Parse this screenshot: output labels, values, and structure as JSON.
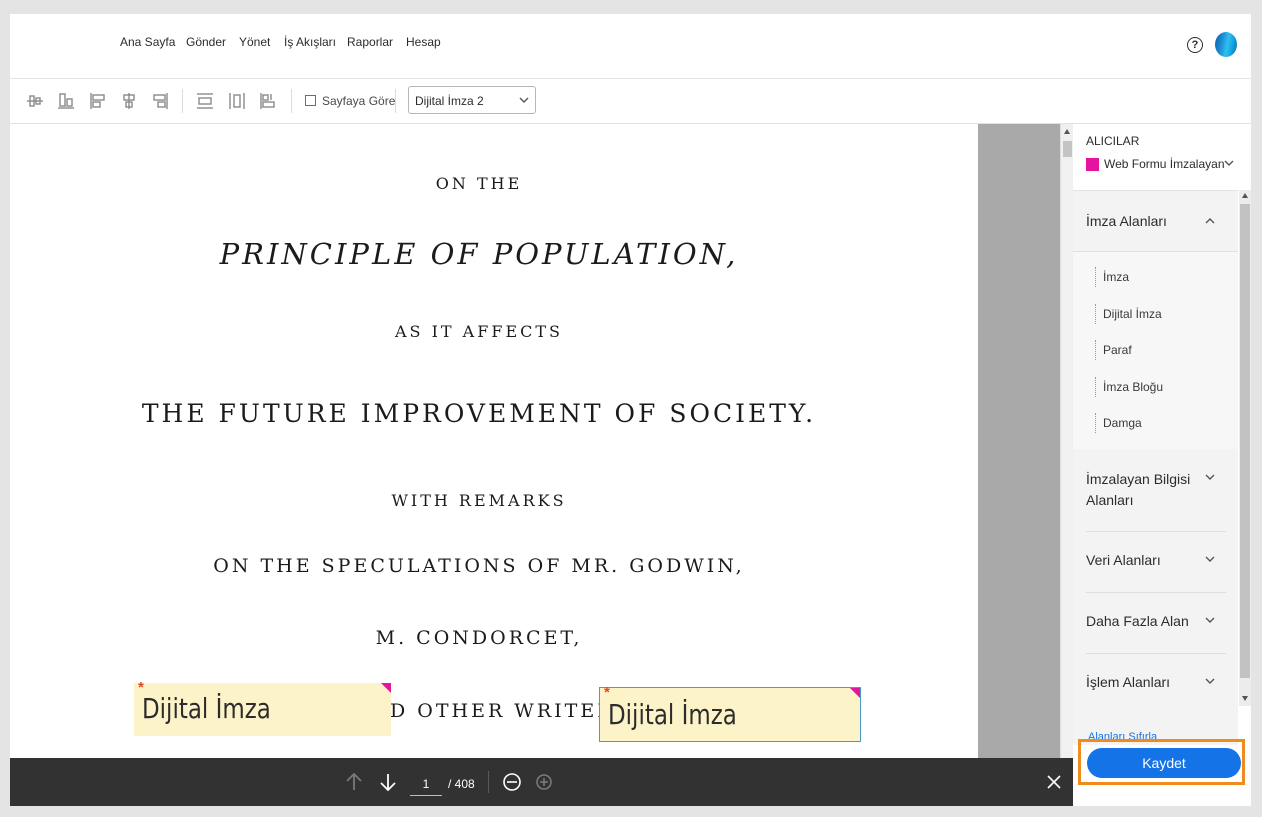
{
  "nav": {
    "items": [
      "Ana Sayfa",
      "Gönder",
      "Yönet",
      "İş Akışları",
      "Raporlar",
      "Hesap"
    ]
  },
  "toolbar": {
    "icons": [
      "align-center-vertical-icon",
      "align-bottom-icon",
      "align-left-icon",
      "align-center-horizontal-icon",
      "align-right-icon",
      "distribute-vertical-icon",
      "distribute-horizontal-icon",
      "match-size-icon"
    ],
    "fit_label": "Sayfaya Göre",
    "field_select": "Dijital İmza 2"
  },
  "document": {
    "lines": [
      "ON THE",
      "PRINCIPLE OF POPULATION,",
      "AS IT AFFECTS",
      "THE FUTURE IMPROVEMENT OF SOCIETY.",
      "WITH REMARKS",
      "ON THE SPECULATIONS OF MR. GODWIN,",
      "M. CONDORCET,",
      "D OTHER WRITERS."
    ],
    "fields": [
      {
        "label": "Dijital İmza",
        "required_mark": "*"
      },
      {
        "label": "Dijital İmza",
        "required_mark": "*"
      }
    ]
  },
  "pagebar": {
    "current_page": "1",
    "total": "/ 408"
  },
  "panel": {
    "recipients_label": "ALICILAR",
    "recipient_name": "Web Formu İmzalayan",
    "recipient_color": "#e5149f",
    "sections": [
      {
        "title": "İmza Alanları",
        "expanded": true,
        "items": [
          "İmza",
          "Dijital İmza",
          "Paraf",
          "İmza Bloğu",
          "Damga"
        ]
      },
      {
        "title": "İmzalayan Bilgisi Alanları",
        "expanded": false
      },
      {
        "title": "Veri Alanları",
        "expanded": false
      },
      {
        "title": "Daha Fazla Alan",
        "expanded": false
      },
      {
        "title": "İşlem Alanları",
        "expanded": false
      }
    ],
    "reset_link": "Alanları Sıfırla",
    "save_button": "Kaydet"
  },
  "colors": {
    "accent": "#1473e6",
    "highlight_outline": "#f08c1e",
    "field_background": "#fdf3c9"
  }
}
